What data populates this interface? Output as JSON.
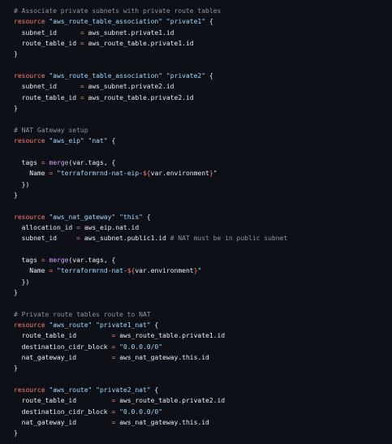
{
  "editor": {
    "language": "terraform",
    "theme": "dark",
    "colors": {
      "background": "#0d1117",
      "text": "#e6edf3",
      "comment": "#8b949e",
      "keyword": "#ff7b72",
      "string": "#a5d6ff",
      "function": "#d2a8ff"
    },
    "lines": [
      [
        {
          "t": "comment",
          "v": "# Associate private subnets with private route tables"
        }
      ],
      [
        {
          "t": "keyword",
          "v": "resource"
        },
        {
          "t": "plain",
          "v": " "
        },
        {
          "t": "string",
          "v": "\"aws_route_table_association\""
        },
        {
          "t": "plain",
          "v": " "
        },
        {
          "t": "string",
          "v": "\"private1\""
        },
        {
          "t": "plain",
          "v": " {"
        }
      ],
      [
        {
          "t": "plain",
          "v": "  subnet_id      "
        },
        {
          "t": "op",
          "v": "="
        },
        {
          "t": "plain",
          "v": " aws_subnet.private1.id"
        }
      ],
      [
        {
          "t": "plain",
          "v": "  route_table_id "
        },
        {
          "t": "op",
          "v": "="
        },
        {
          "t": "plain",
          "v": " aws_route_table.private1.id"
        }
      ],
      [
        {
          "t": "plain",
          "v": "}"
        }
      ],
      [],
      [
        {
          "t": "keyword",
          "v": "resource"
        },
        {
          "t": "plain",
          "v": " "
        },
        {
          "t": "string",
          "v": "\"aws_route_table_association\""
        },
        {
          "t": "plain",
          "v": " "
        },
        {
          "t": "string",
          "v": "\"private2\""
        },
        {
          "t": "plain",
          "v": " {"
        }
      ],
      [
        {
          "t": "plain",
          "v": "  subnet_id      "
        },
        {
          "t": "op",
          "v": "="
        },
        {
          "t": "plain",
          "v": " aws_subnet.private2.id"
        }
      ],
      [
        {
          "t": "plain",
          "v": "  route_table_id "
        },
        {
          "t": "op",
          "v": "="
        },
        {
          "t": "plain",
          "v": " aws_route_table.private2.id"
        }
      ],
      [
        {
          "t": "plain",
          "v": "}"
        }
      ],
      [],
      [
        {
          "t": "comment",
          "v": "# NAT Gateway setup"
        }
      ],
      [
        {
          "t": "keyword",
          "v": "resource"
        },
        {
          "t": "plain",
          "v": " "
        },
        {
          "t": "string",
          "v": "\"aws_eip\""
        },
        {
          "t": "plain",
          "v": " "
        },
        {
          "t": "string",
          "v": "\"nat\""
        },
        {
          "t": "plain",
          "v": " {"
        }
      ],
      [],
      [
        {
          "t": "plain",
          "v": "  tags "
        },
        {
          "t": "op",
          "v": "="
        },
        {
          "t": "plain",
          "v": " "
        },
        {
          "t": "func",
          "v": "merge"
        },
        {
          "t": "plain",
          "v": "(var.tags, {"
        }
      ],
      [
        {
          "t": "plain",
          "v": "    Name "
        },
        {
          "t": "op",
          "v": "="
        },
        {
          "t": "plain",
          "v": " "
        },
        {
          "t": "string",
          "v": "\"terraformrnd-nat-eip-"
        },
        {
          "t": "interp",
          "v": "${"
        },
        {
          "t": "plain",
          "v": "var.environment"
        },
        {
          "t": "interp",
          "v": "}"
        },
        {
          "t": "string",
          "v": "\""
        }
      ],
      [
        {
          "t": "plain",
          "v": "  })"
        }
      ],
      [
        {
          "t": "plain",
          "v": "}"
        }
      ],
      [],
      [
        {
          "t": "keyword",
          "v": "resource"
        },
        {
          "t": "plain",
          "v": " "
        },
        {
          "t": "string",
          "v": "\"aws_nat_gateway\""
        },
        {
          "t": "plain",
          "v": " "
        },
        {
          "t": "string",
          "v": "\"this\""
        },
        {
          "t": "plain",
          "v": " {"
        }
      ],
      [
        {
          "t": "plain",
          "v": "  allocation_id "
        },
        {
          "t": "op",
          "v": "="
        },
        {
          "t": "plain",
          "v": " aws_eip.nat.id"
        }
      ],
      [
        {
          "t": "plain",
          "v": "  subnet_id     "
        },
        {
          "t": "op",
          "v": "="
        },
        {
          "t": "plain",
          "v": " aws_subnet.public1.id "
        },
        {
          "t": "comment",
          "v": "# NAT must be in public subnet"
        }
      ],
      [],
      [
        {
          "t": "plain",
          "v": "  tags "
        },
        {
          "t": "op",
          "v": "="
        },
        {
          "t": "plain",
          "v": " "
        },
        {
          "t": "func",
          "v": "merge"
        },
        {
          "t": "plain",
          "v": "(var.tags, {"
        }
      ],
      [
        {
          "t": "plain",
          "v": "    Name "
        },
        {
          "t": "op",
          "v": "="
        },
        {
          "t": "plain",
          "v": " "
        },
        {
          "t": "string",
          "v": "\"terraformrnd-nat-"
        },
        {
          "t": "interp",
          "v": "${"
        },
        {
          "t": "plain",
          "v": "var.environment"
        },
        {
          "t": "interp",
          "v": "}"
        },
        {
          "t": "string",
          "v": "\""
        }
      ],
      [
        {
          "t": "plain",
          "v": "  })"
        }
      ],
      [
        {
          "t": "plain",
          "v": "}"
        }
      ],
      [],
      [
        {
          "t": "comment",
          "v": "# Private route tables route to NAT"
        }
      ],
      [
        {
          "t": "keyword",
          "v": "resource"
        },
        {
          "t": "plain",
          "v": " "
        },
        {
          "t": "string",
          "v": "\"aws_route\""
        },
        {
          "t": "plain",
          "v": " "
        },
        {
          "t": "string",
          "v": "\"private1_nat\""
        },
        {
          "t": "plain",
          "v": " {"
        }
      ],
      [
        {
          "t": "plain",
          "v": "  route_table_id         "
        },
        {
          "t": "op",
          "v": "="
        },
        {
          "t": "plain",
          "v": " aws_route_table.private1.id"
        }
      ],
      [
        {
          "t": "plain",
          "v": "  destination_cidr_block "
        },
        {
          "t": "op",
          "v": "="
        },
        {
          "t": "plain",
          "v": " "
        },
        {
          "t": "string",
          "v": "\"0.0.0.0/0\""
        }
      ],
      [
        {
          "t": "plain",
          "v": "  nat_gateway_id         "
        },
        {
          "t": "op",
          "v": "="
        },
        {
          "t": "plain",
          "v": " aws_nat_gateway.this.id"
        }
      ],
      [
        {
          "t": "plain",
          "v": "}"
        }
      ],
      [],
      [
        {
          "t": "keyword",
          "v": "resource"
        },
        {
          "t": "plain",
          "v": " "
        },
        {
          "t": "string",
          "v": "\"aws_route\""
        },
        {
          "t": "plain",
          "v": " "
        },
        {
          "t": "string",
          "v": "\"private2_nat\""
        },
        {
          "t": "plain",
          "v": " {"
        }
      ],
      [
        {
          "t": "plain",
          "v": "  route_table_id         "
        },
        {
          "t": "op",
          "v": "="
        },
        {
          "t": "plain",
          "v": " aws_route_table.private2.id"
        }
      ],
      [
        {
          "t": "plain",
          "v": "  destination_cidr_block "
        },
        {
          "t": "op",
          "v": "="
        },
        {
          "t": "plain",
          "v": " "
        },
        {
          "t": "string",
          "v": "\"0.0.0.0/0\""
        }
      ],
      [
        {
          "t": "plain",
          "v": "  nat_gateway_id         "
        },
        {
          "t": "op",
          "v": "="
        },
        {
          "t": "plain",
          "v": " aws_nat_gateway.this.id"
        }
      ],
      [
        {
          "t": "plain",
          "v": "}"
        }
      ]
    ]
  }
}
